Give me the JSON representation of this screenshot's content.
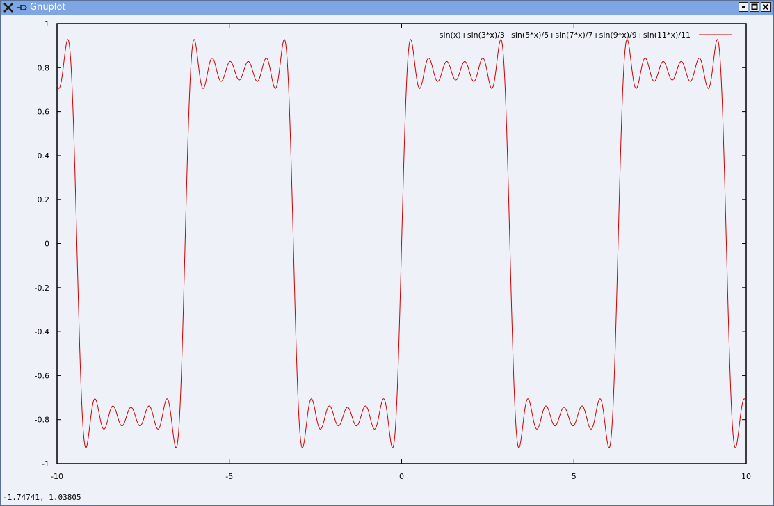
{
  "window": {
    "title": "Gnuplot",
    "icons": {
      "menu": "x-icon",
      "pin": "pin-icon",
      "minimize": "minimize-icon",
      "maximize": "maximize-icon",
      "close": "close-icon"
    }
  },
  "statusbar": {
    "coords": "-1.74741,  1.03805"
  },
  "colors": {
    "curve": "#cc0000",
    "background": "#eef2f8",
    "titlebar": "#7ea6e4"
  },
  "chart_data": {
    "type": "line",
    "title": "",
    "xlabel": "",
    "ylabel": "",
    "xlim": [
      -10,
      10
    ],
    "ylim": [
      -1,
      1
    ],
    "xticks": [
      -10,
      -5,
      0,
      5,
      10
    ],
    "yticks": [
      -1,
      -0.8,
      -0.6,
      -0.4,
      -0.2,
      0,
      0.2,
      0.4,
      0.6,
      0.8,
      1
    ],
    "xtick_labels": [
      "-10",
      "-5",
      "0",
      "5",
      "10"
    ],
    "ytick_labels": [
      "-1",
      "-0.8",
      "-0.6",
      "-0.4",
      "-0.2",
      "0",
      "0.2",
      "0.4",
      "0.6",
      "0.8",
      "1"
    ],
    "grid": false,
    "legend_position": "top-right",
    "series": [
      {
        "name": "sin(x)+sin(3*x)/3+sin(5*x)/5+sin(7*x)/7+sin(9*x)/9+sin(11*x)/11",
        "color": "#cc0000",
        "function_terms": [
          1,
          3,
          5,
          7,
          9,
          11
        ]
      }
    ]
  }
}
